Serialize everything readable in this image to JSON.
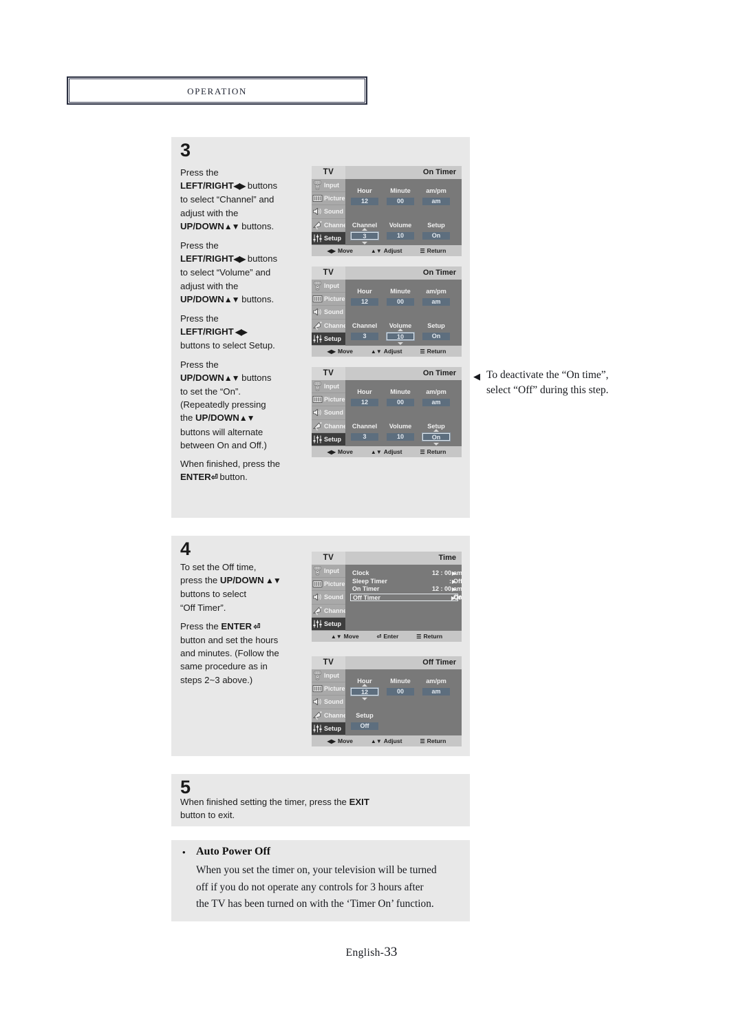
{
  "header": {
    "title": "Operation"
  },
  "footer": {
    "language": "English-",
    "page": "33"
  },
  "steps": {
    "three": {
      "number": "3",
      "lines": [
        {
          "t": "Press the",
          "b": false
        },
        {
          "t": "LEFT/RIGHT",
          "b": true,
          "glyph": "◀▶",
          "tail": " buttons"
        },
        {
          "t": "to select “Channel” and",
          "b": false
        },
        {
          "t": "adjust with the",
          "b": false
        },
        {
          "t": "UP/DOWN",
          "b": true,
          "glyph": "▲▼",
          "tail": " buttons."
        },
        {
          "t": "",
          "b": false
        },
        {
          "t": "Press the",
          "b": false
        },
        {
          "t": "LEFT/RIGHT",
          "b": true,
          "glyph": "◀▶",
          "tail": " buttons"
        },
        {
          "t": "to select “Volume” and",
          "b": false
        },
        {
          "t": "adjust with the",
          "b": false
        },
        {
          "t": "UP/DOWN",
          "b": true,
          "glyph": "▲▼",
          "tail": " buttons."
        },
        {
          "t": "",
          "b": false
        },
        {
          "t": "Press the",
          "b": false
        },
        {
          "t": "LEFT/RIGHT",
          "b": true,
          "glyph": " ◀▶",
          "tail": ""
        },
        {
          "t": "buttons to select Setup.",
          "b": false
        },
        {
          "t": "",
          "b": false
        },
        {
          "t": "Press the",
          "b": false
        },
        {
          "t": "UP/DOWN",
          "b": true,
          "glyph": "▲▼",
          "tail": " buttons"
        },
        {
          "t": "to set the “On”.",
          "b": false
        },
        {
          "t": "(Repeatedly pressing",
          "b": false
        },
        {
          "t": "the UP/DOWN",
          "b": false,
          "boldpart": "UP/DOWN",
          "glyph": "▲▼",
          "tail": ""
        },
        {
          "t": "buttons will alternate",
          "b": false
        },
        {
          "t": "between On and Off.)",
          "b": false
        },
        {
          "t": "",
          "b": false
        },
        {
          "t": "When finished, press the",
          "b": false
        },
        {
          "t": "ENTER",
          "b": true,
          "glyph": "⏎",
          "tail": " button."
        }
      ]
    },
    "four": {
      "number": "4",
      "lines": [
        {
          "t": "To set the Off time,"
        },
        {
          "t": "press the UP/DOWN ▲▼"
        },
        {
          "t": "buttons to select"
        },
        {
          "t": "“Off Timer”."
        },
        {
          "t": ""
        },
        {
          "t": "Press the ENTER ⏎"
        },
        {
          "t": "button and set the hours"
        },
        {
          "t": "and minutes. (Follow the"
        },
        {
          "t": "same procedure as in"
        },
        {
          "t": "steps 2~3 above.)"
        }
      ]
    },
    "five": {
      "number": "5",
      "line1": "When finished setting the timer, press the ",
      "bold": "EXIT",
      "line2": "button to exit."
    }
  },
  "callout": {
    "arrow": "◀",
    "line1": "To deactivate the “On time”,",
    "line2": "select “Off” during this step."
  },
  "note": {
    "bullet": "•",
    "title": "Auto Power Off",
    "line1": "When you set the timer on, your television will be turned",
    "line2": "off if you do not operate any controls for 3 hours after",
    "line3": "the TV has been turned on with the ‘Timer On’ function."
  },
  "osd_common": {
    "tv_label": "TV",
    "sidebar": [
      {
        "label": "Input",
        "icon": "remote-icon"
      },
      {
        "label": "Picture",
        "icon": "screen-icon"
      },
      {
        "label": "Sound",
        "icon": "speaker-icon"
      },
      {
        "label": "Channel",
        "icon": "satellite-dish-icon"
      },
      {
        "label": "Setup",
        "icon": "sliders-icon"
      }
    ],
    "bottom_adjust": [
      {
        "icon": "◀▶",
        "label": "Move"
      },
      {
        "icon": "▲▼",
        "label": "Adjust"
      },
      {
        "icon": "☰",
        "label": "Return"
      }
    ],
    "bottom_enter": [
      {
        "icon": "▲▼",
        "label": "Move"
      },
      {
        "icon": "⏎",
        "label": "Enter"
      },
      {
        "icon": "☰",
        "label": "Return"
      }
    ],
    "colors": {
      "value_box": "#5d6e7e",
      "panel_bg": "#797979",
      "sidebar_bg": "#a9a9a9",
      "active_item": "#3d3d3d",
      "title_bar": "#c9c9c9"
    }
  },
  "osd_screens": [
    {
      "id": "on-timer-channel",
      "title": "On Timer",
      "active_sidebar": "Setup",
      "type": "grid",
      "labels": [
        "Hour",
        "Minute",
        "am/pm",
        "Channel",
        "Volume",
        "Setup"
      ],
      "values": [
        "12",
        "00",
        "am",
        "3",
        "10",
        "On"
      ],
      "selected": "Channel",
      "bottom": "adjust"
    },
    {
      "id": "on-timer-volume",
      "title": "On Timer",
      "active_sidebar": "Setup",
      "type": "grid",
      "labels": [
        "Hour",
        "Minute",
        "am/pm",
        "Channel",
        "Volume",
        "Setup"
      ],
      "values": [
        "12",
        "00",
        "am",
        "3",
        "10",
        "On"
      ],
      "selected": "Volume",
      "bottom": "adjust"
    },
    {
      "id": "on-timer-setup",
      "title": "On Timer",
      "active_sidebar": "Setup",
      "type": "grid",
      "labels": [
        "Hour",
        "Minute",
        "am/pm",
        "Channel",
        "Volume",
        "Setup"
      ],
      "values": [
        "12",
        "00",
        "am",
        "3",
        "10",
        "On"
      ],
      "selected": "Setup",
      "bottom": "adjust"
    },
    {
      "id": "time-menu",
      "title": "Time",
      "active_sidebar": "Setup",
      "type": "list",
      "rows": [
        {
          "name": "Clock",
          "v1": "12 : 00",
          "v2": "am",
          "arrow": "▶",
          "selected": false
        },
        {
          "name": "Sleep Timer",
          "v1": ":",
          "v2": "Off",
          "arrow": "▶",
          "selected": false
        },
        {
          "name": "On Timer",
          "v1": "12 : 00",
          "v2": "am On",
          "arrow": "▶",
          "selected": false
        },
        {
          "name": "Off Timer",
          "v1": "",
          "v2": "Off",
          "arrow": "▶",
          "selected": true
        }
      ],
      "bottom": "enter"
    },
    {
      "id": "off-timer",
      "title": "Off Timer",
      "active_sidebar": "Setup",
      "type": "grid2",
      "labels": [
        "Hour",
        "Minute",
        "am/pm",
        "Setup"
      ],
      "values": [
        "12",
        "00",
        "am",
        "Off"
      ],
      "selected": "Hour",
      "bottom": "adjust"
    }
  ]
}
